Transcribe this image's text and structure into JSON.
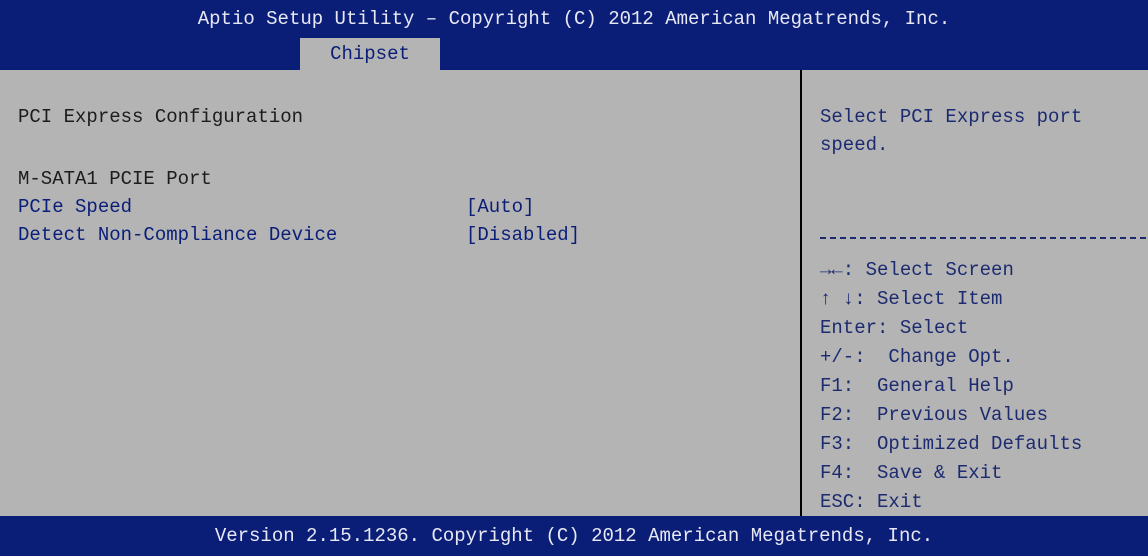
{
  "header": {
    "title": "Aptio Setup Utility – Copyright (C) 2012 American Megatrends, Inc.",
    "tab": "Chipset"
  },
  "main": {
    "section_title": "PCI Express Configuration",
    "subsection": "M-SATA1 PCIE Port",
    "options": [
      {
        "label": "PCIe Speed",
        "value": "[Auto]"
      },
      {
        "label": "Detect Non-Compliance Device",
        "value": "[Disabled]"
      }
    ]
  },
  "help": {
    "description_line1": "Select PCI Express port",
    "description_line2": "speed.",
    "keys": [
      {
        "key": "→←:",
        "desc": " Select Screen"
      },
      {
        "key": "↑ ↓:",
        "desc": " Select Item"
      },
      {
        "key": "Enter:",
        "desc": " Select"
      },
      {
        "key": "+/-:",
        "desc": "  Change Opt."
      },
      {
        "key": "F1:",
        "desc": "  General Help"
      },
      {
        "key": "F2:",
        "desc": "  Previous Values"
      },
      {
        "key": "F3:",
        "desc": "  Optimized Defaults"
      },
      {
        "key": "F4:",
        "desc": "  Save & Exit"
      },
      {
        "key": "ESC:",
        "desc": " Exit"
      }
    ]
  },
  "footer": {
    "version": "Version 2.15.1236. Copyright (C) 2012 American Megatrends, Inc."
  },
  "colors": {
    "header_bg": "#0a1e78",
    "body_bg": "#b4b4b4",
    "option_text": "#0a1e78"
  }
}
